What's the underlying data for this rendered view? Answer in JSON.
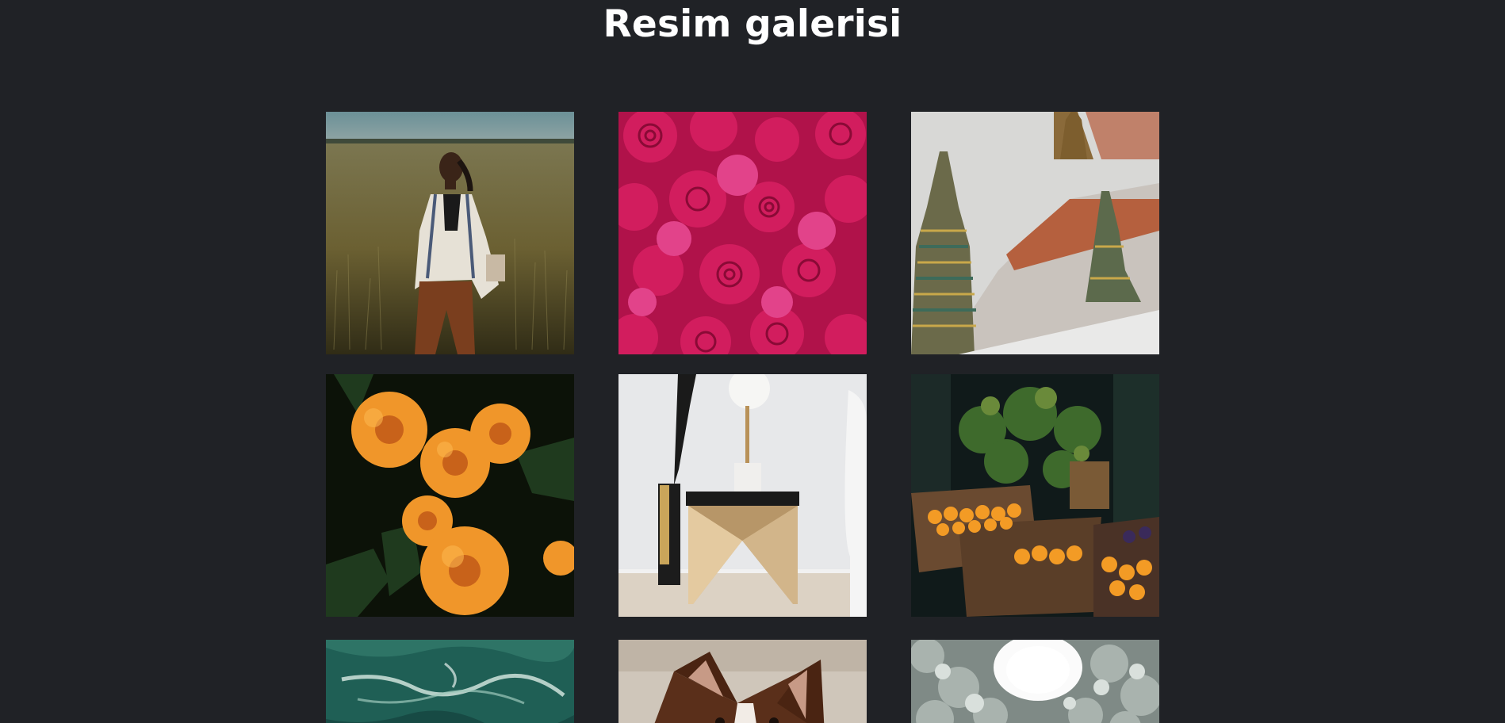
{
  "page": {
    "title": "Resim galerisi",
    "background": "#202226"
  },
  "gallery": {
    "images": [
      {
        "subject": "woman-in-field"
      },
      {
        "subject": "pink-roses"
      },
      {
        "subject": "temple-spires"
      },
      {
        "subject": "orange-dahlias"
      },
      {
        "subject": "side-table-lamp"
      },
      {
        "subject": "market-produce"
      },
      {
        "subject": "aerial-sea"
      },
      {
        "subject": "dog"
      },
      {
        "subject": "snowy-forest"
      }
    ]
  }
}
